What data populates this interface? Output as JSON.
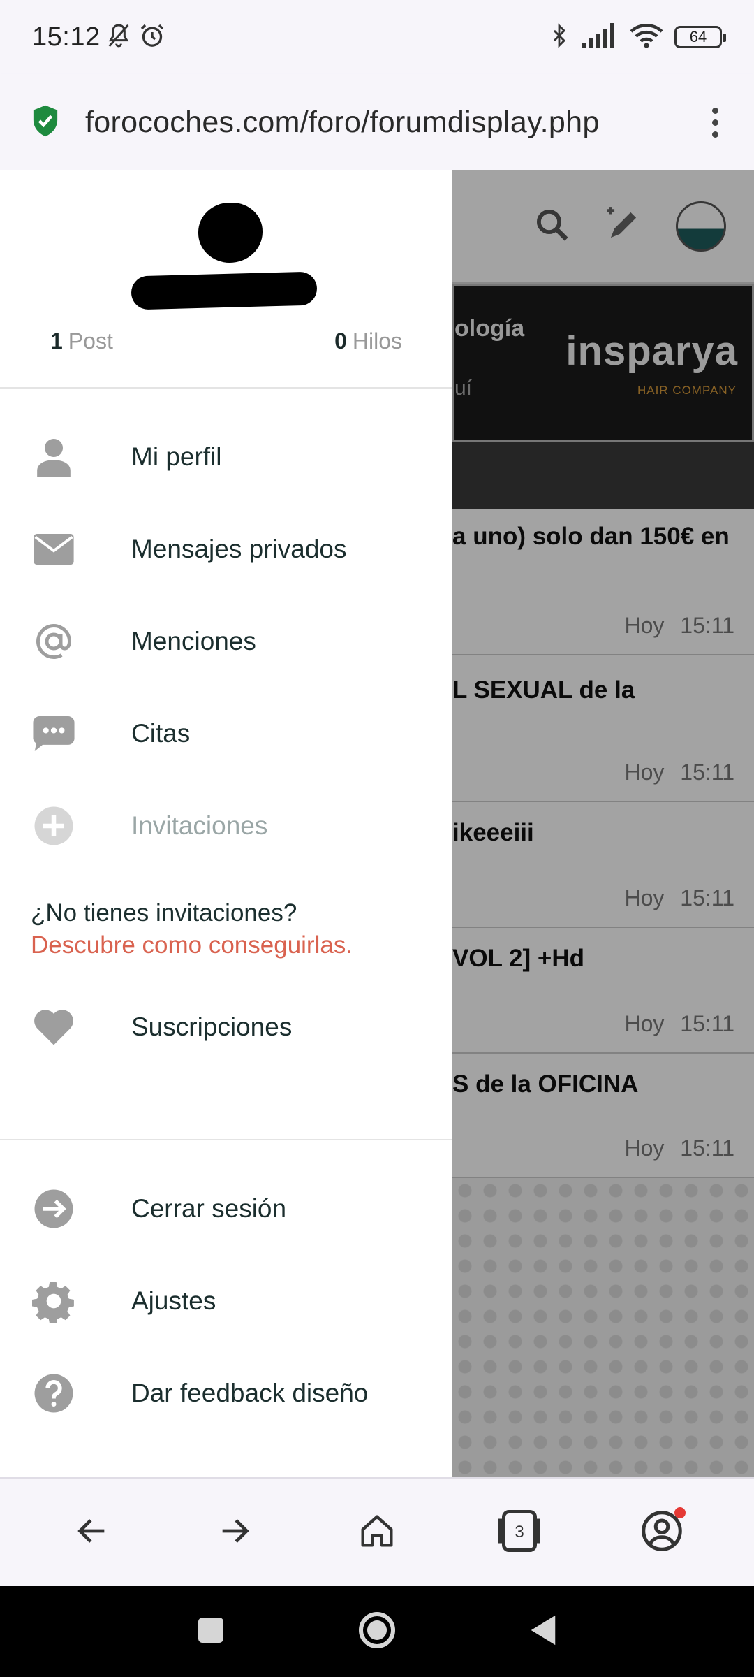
{
  "status_bar": {
    "time": "15:12",
    "battery": "64"
  },
  "url_bar": {
    "url": "forocoches.com/foro/forumdisplay.php"
  },
  "background_page": {
    "banner_text_1": "ología",
    "banner_text_2": "uí",
    "banner_logo": "insparya",
    "banner_logo_sub": "HAIR COMPANY",
    "threads": [
      {
        "title": "a uno) solo dan 150€ en",
        "date": "Hoy 15:11"
      },
      {
        "title": "L SEXUAL de la",
        "date": "Hoy 15:11"
      },
      {
        "title": "ikeeeiii",
        "date": "Hoy 15:11"
      },
      {
        "title": "VOL 2] +Hd",
        "date": "Hoy 15:11"
      },
      {
        "title": "S de la OFICINA",
        "date": "Hoy 15:11"
      }
    ]
  },
  "drawer": {
    "profile": {
      "posts_count": "1",
      "posts_label": "Post",
      "threads_count": "0",
      "threads_label": "Hilos"
    },
    "menu": {
      "profile": "Mi perfil",
      "messages": "Mensajes privados",
      "mentions": "Menciones",
      "quotes": "Citas",
      "invitations": "Invitaciones",
      "subscriptions": "Suscripciones",
      "logout": "Cerrar sesión",
      "settings": "Ajustes",
      "feedback": "Dar feedback diseño"
    },
    "invitation_note": {
      "question": "¿No tienes invitaciones?",
      "link": "Descubre como conseguirlas."
    }
  },
  "toolbar": {
    "tabs_count": "3"
  },
  "colors": {
    "accent_link": "#d9624f",
    "icon_gray": "#9e9e9e",
    "text_dark": "#1b2e2e",
    "secure_green": "#1e8a3e"
  }
}
